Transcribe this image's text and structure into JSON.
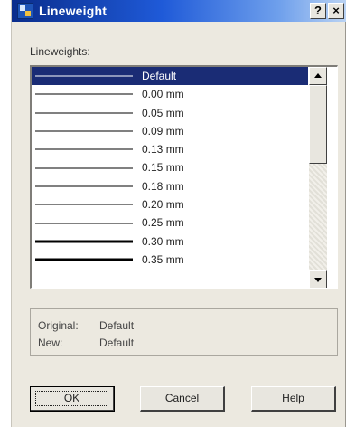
{
  "window": {
    "title": "Lineweight",
    "help_button": "?",
    "close_button": "×"
  },
  "list": {
    "label": "Lineweights:",
    "items": [
      {
        "label": "Default",
        "weight": "default",
        "selected": true
      },
      {
        "label": "0.00 mm",
        "weight": "0.00"
      },
      {
        "label": "0.05 mm",
        "weight": "0.05"
      },
      {
        "label": "0.09 mm",
        "weight": "0.09"
      },
      {
        "label": "0.13 mm",
        "weight": "0.13"
      },
      {
        "label": "0.15 mm",
        "weight": "0.15"
      },
      {
        "label": "0.18 mm",
        "weight": "0.18"
      },
      {
        "label": "0.20 mm",
        "weight": "0.20"
      },
      {
        "label": "0.25 mm",
        "weight": "0.25"
      },
      {
        "label": "0.30 mm",
        "weight": "0.30"
      },
      {
        "label": "0.35 mm",
        "weight": "0.35"
      }
    ]
  },
  "info": {
    "original_label": "Original:",
    "original_value": "Default",
    "new_label": "New:",
    "new_value": "Default"
  },
  "buttons": {
    "ok": "OK",
    "cancel": "Cancel",
    "help_prefix": "",
    "help_mnemonic": "H",
    "help_rest": "elp"
  },
  "colors": {
    "selection": "#1a2c75",
    "title_start": "#0a2d8c",
    "dialog_bg": "#ece9e0"
  }
}
